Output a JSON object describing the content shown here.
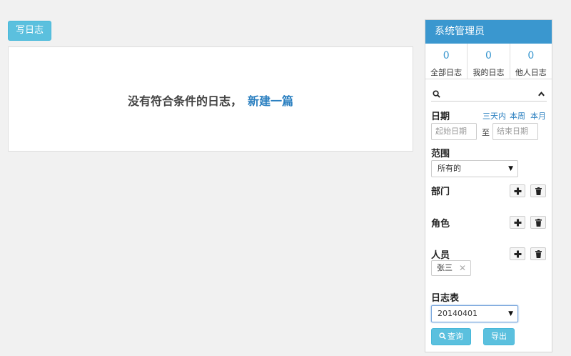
{
  "toolbar": {
    "write_label": "写日志"
  },
  "empty_state": {
    "message": "没有符合条件的日志，",
    "link": "新建一篇"
  },
  "sidebar": {
    "title": "系统管理员",
    "stats": [
      {
        "count": "0",
        "label": "全部日志"
      },
      {
        "count": "0",
        "label": "我的日志"
      },
      {
        "count": "0",
        "label": "他人日志"
      }
    ],
    "filter": {
      "date_label": "日期",
      "quick_ranges": [
        "三天内",
        "本周",
        "本月"
      ],
      "start_placeholder": "起始日期",
      "to_label": "至",
      "end_placeholder": "结束日期",
      "scope_label": "范围",
      "scope_value": "所有的",
      "department_label": "部门",
      "role_label": "角色",
      "person_label": "人员",
      "person_chip": "张三",
      "log_table_label": "日志表",
      "log_table_value": "20140401",
      "query_label": "查询",
      "export_label": "导出"
    }
  },
  "colors": {
    "accent": "#3a97cf",
    "button": "#5bc0de",
    "link": "#2a7fc0"
  }
}
